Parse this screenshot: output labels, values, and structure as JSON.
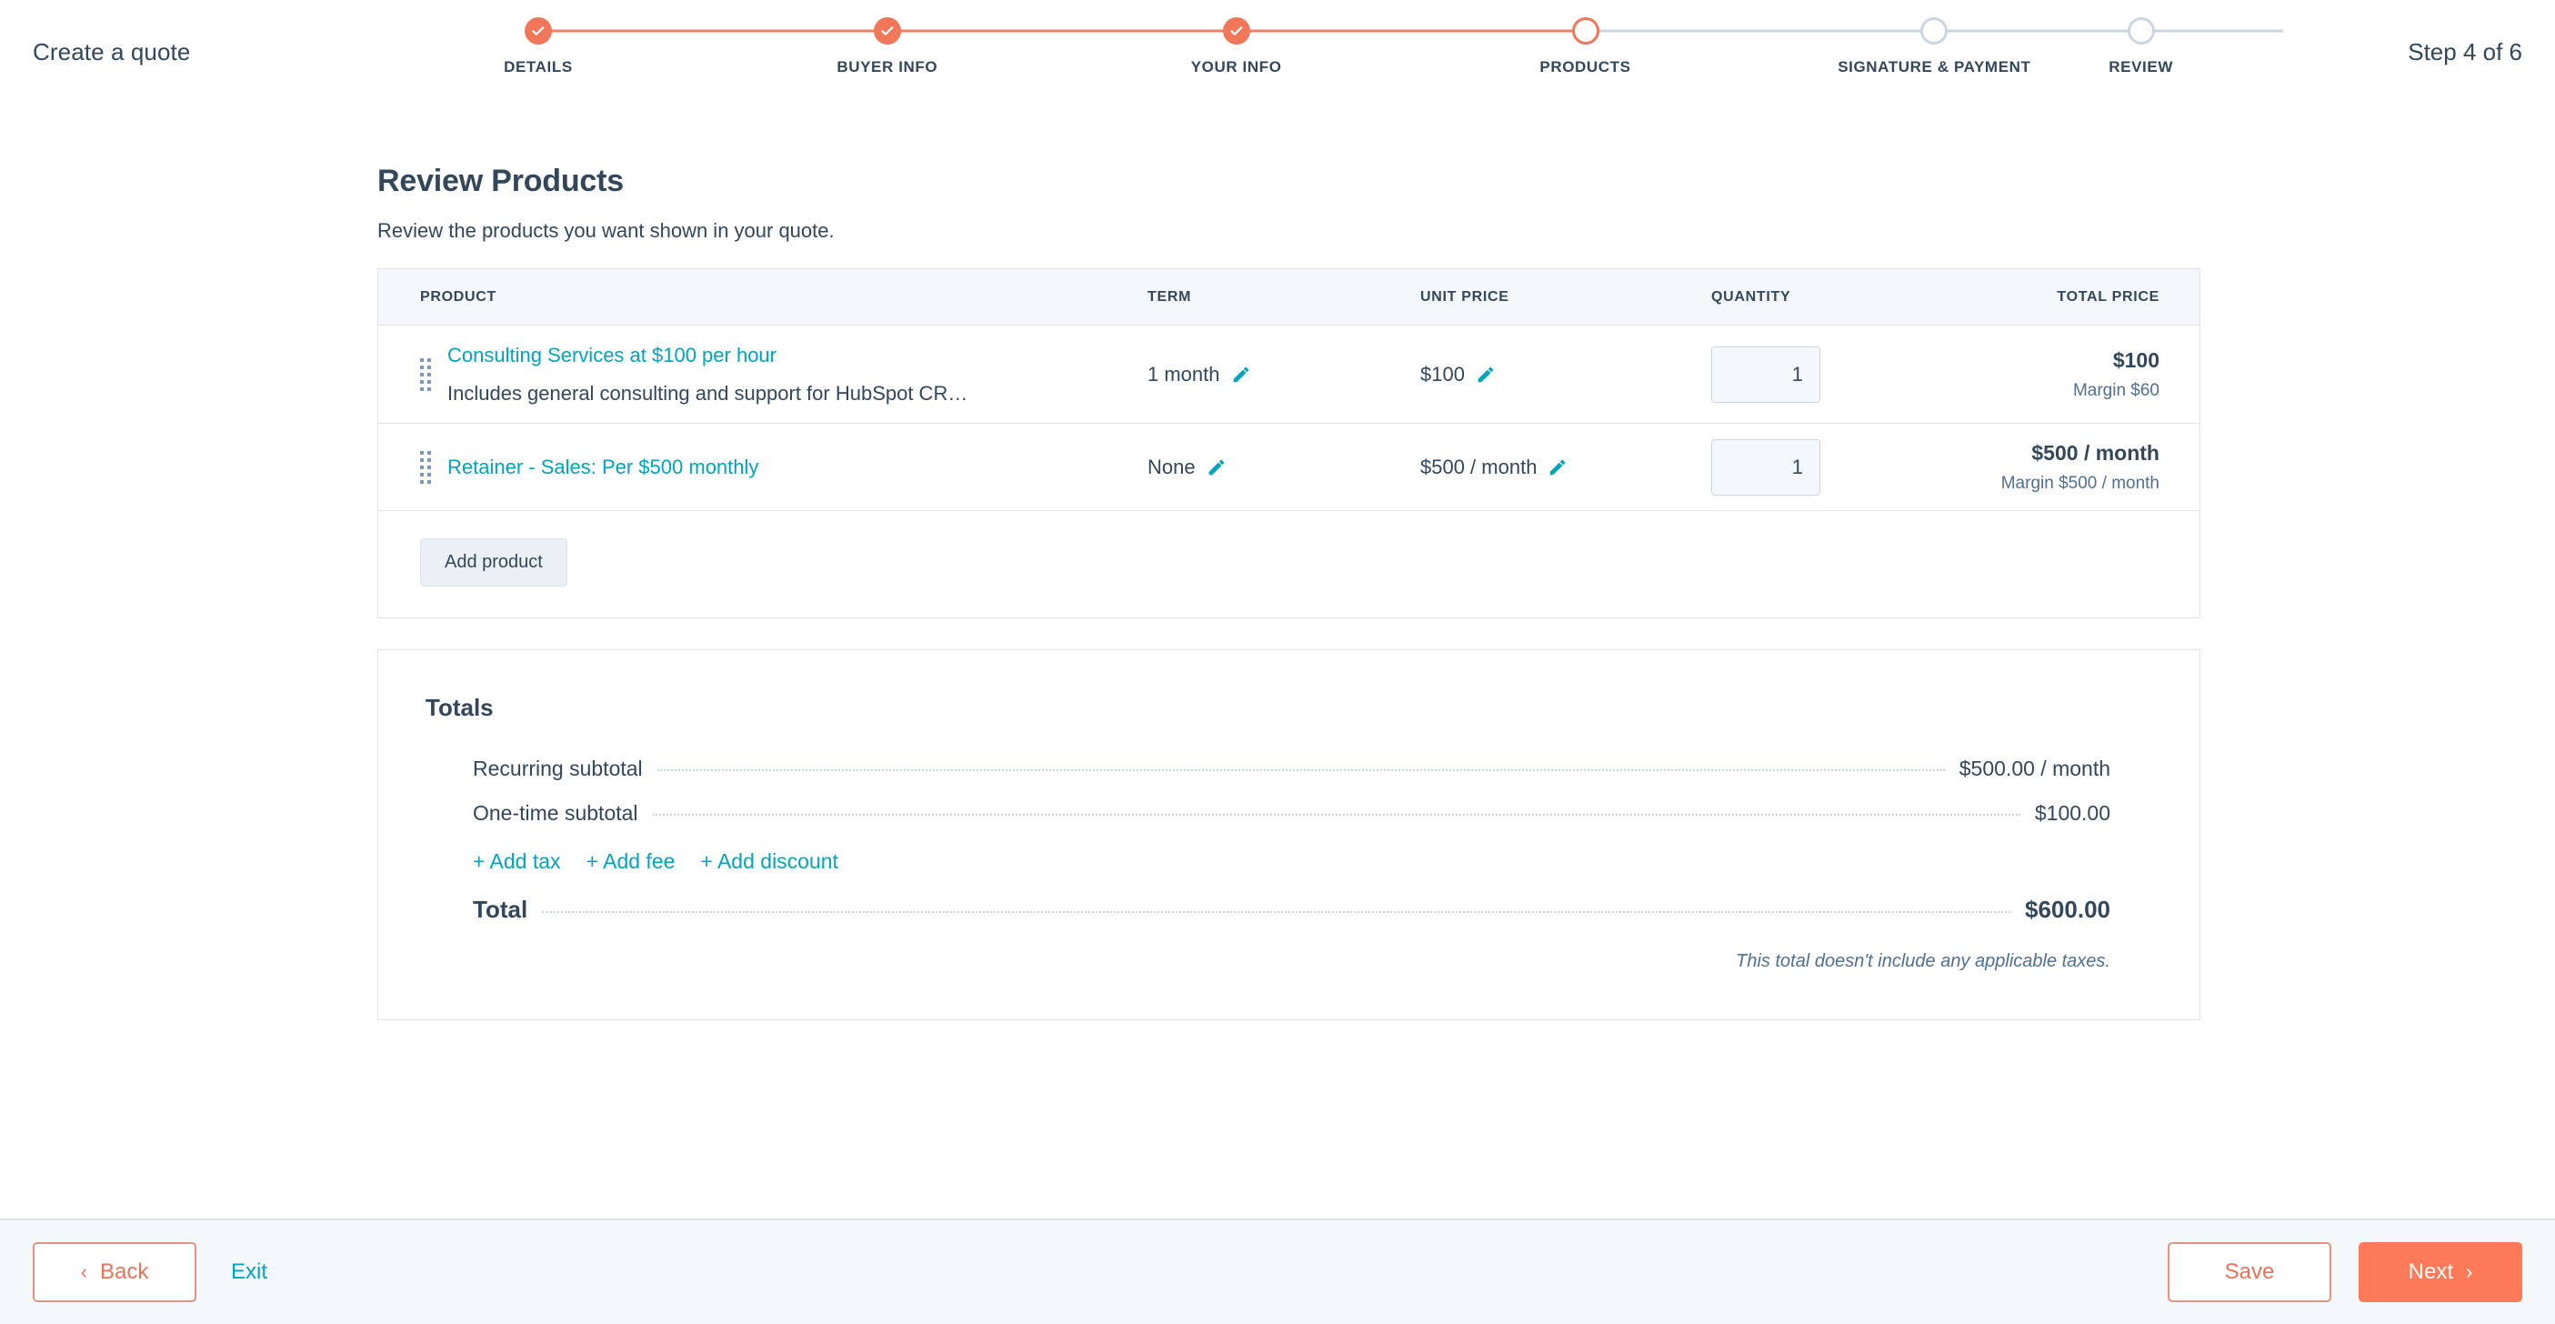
{
  "header": {
    "title": "Create a quote",
    "step_count": "Step 4 of 6",
    "steps": [
      {
        "label": "DETAILS",
        "state": "done"
      },
      {
        "label": "BUYER INFO",
        "state": "done"
      },
      {
        "label": "YOUR INFO",
        "state": "done"
      },
      {
        "label": "PRODUCTS",
        "state": "current"
      },
      {
        "label": "SIGNATURE & PAYMENT",
        "state": "future"
      },
      {
        "label": "REVIEW",
        "state": "future"
      }
    ]
  },
  "main": {
    "page_title": "Review Products",
    "page_subtitle": "Review the products you want shown in your quote.",
    "table": {
      "columns": {
        "product": "PRODUCT",
        "term": "TERM",
        "unit_price": "UNIT PRICE",
        "quantity": "QUANTITY",
        "total_price": "TOTAL PRICE"
      },
      "rows": [
        {
          "name": "Consulting Services at $100 per hour",
          "description": "Includes general consulting and support for HubSpot CR…",
          "term": "1 month",
          "unit_price": "$100",
          "quantity": "1",
          "total_price": "$100",
          "margin": "Margin $60"
        },
        {
          "name": "Retainer - Sales: Per $500 monthly",
          "description": "",
          "term": "None",
          "unit_price": "$500 / month",
          "quantity": "1",
          "total_price": "$500 / month",
          "margin": "Margin $500 / month"
        }
      ],
      "add_product_label": "Add product"
    },
    "totals": {
      "title": "Totals",
      "recurring_subtotal_label": "Recurring subtotal",
      "recurring_subtotal_value": "$500.00 / month",
      "onetime_subtotal_label": "One-time subtotal",
      "onetime_subtotal_value": "$100.00",
      "add_tax_label": "+ Add tax",
      "add_fee_label": "+ Add fee",
      "add_discount_label": "+ Add discount",
      "total_label": "Total",
      "total_value": "$600.00",
      "note": "This total doesn't include any applicable taxes."
    }
  },
  "footer": {
    "back_label": "Back",
    "exit_label": "Exit",
    "save_label": "Save",
    "next_label": "Next"
  },
  "colors": {
    "accent_orange": "#ff7a59",
    "step_orange": "#f2775a",
    "link_teal": "#00a4bd",
    "text_dark": "#33475b",
    "text_muted": "#516f90",
    "border": "#dfe3eb",
    "panel_bg": "#f5f8fa"
  }
}
